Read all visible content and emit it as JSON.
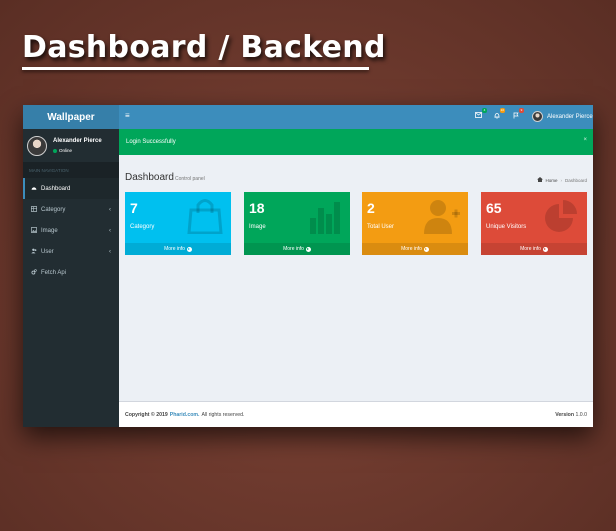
{
  "banner": {
    "title": "Dashboard / Backend"
  },
  "app": {
    "logo": "Wallpaper"
  },
  "user": {
    "name": "Alexander Pierce",
    "status": "Online"
  },
  "sidebar": {
    "header": "MAIN NAVIGATION",
    "items": [
      {
        "label": "Dashboard",
        "icon": "dashboard-icon",
        "active": true
      },
      {
        "label": "Category",
        "icon": "table-icon"
      },
      {
        "label": "Image",
        "icon": "image-icon"
      },
      {
        "label": "User",
        "icon": "users-icon"
      },
      {
        "label": "Fetch Api",
        "icon": "cogs-icon"
      }
    ]
  },
  "topbar": {
    "menu_icon": "hamburger-icon",
    "notifications": [
      {
        "icon": "envelope-icon",
        "badge": "4",
        "color": "#00a65a"
      },
      {
        "icon": "bell-icon",
        "badge": "10",
        "color": "#f39c12"
      },
      {
        "icon": "flag-icon",
        "badge": "9",
        "color": "#dd4b39"
      }
    ],
    "user_name": "Alexander Pierce"
  },
  "alert": {
    "message": "Login Successfully"
  },
  "content_header": {
    "title": "Dashboard",
    "subtitle": "Control panel"
  },
  "breadcrumb": {
    "home": "Home",
    "current": "Dashboard"
  },
  "stats": [
    {
      "value": "7",
      "label": "Category",
      "footer": "More info",
      "color": "#00c0ef",
      "icon": "shopping-bag-icon"
    },
    {
      "value": "18",
      "label": "Image",
      "footer": "More info",
      "color": "#00a65a",
      "icon": "bar-chart-icon"
    },
    {
      "value": "2",
      "label": "Total User",
      "footer": "More info",
      "color": "#f39c12",
      "icon": "user-plus-icon"
    },
    {
      "value": "65",
      "label": "Unique Visitors",
      "footer": "More info",
      "color": "#dd4b39",
      "icon": "pie-chart-icon"
    }
  ],
  "footer": {
    "copyright": "Copyright © 2019",
    "link": "Pharid.com.",
    "rights": "All rights reserved.",
    "version_label": "Version",
    "version": "1.0.0"
  },
  "colors": {
    "background": "#6e3a2e",
    "topbar": "#3c8dbc",
    "logo": "#367fa9",
    "sidebar": "#222d32",
    "alert": "#00a65a",
    "content": "#ecf0f5"
  }
}
